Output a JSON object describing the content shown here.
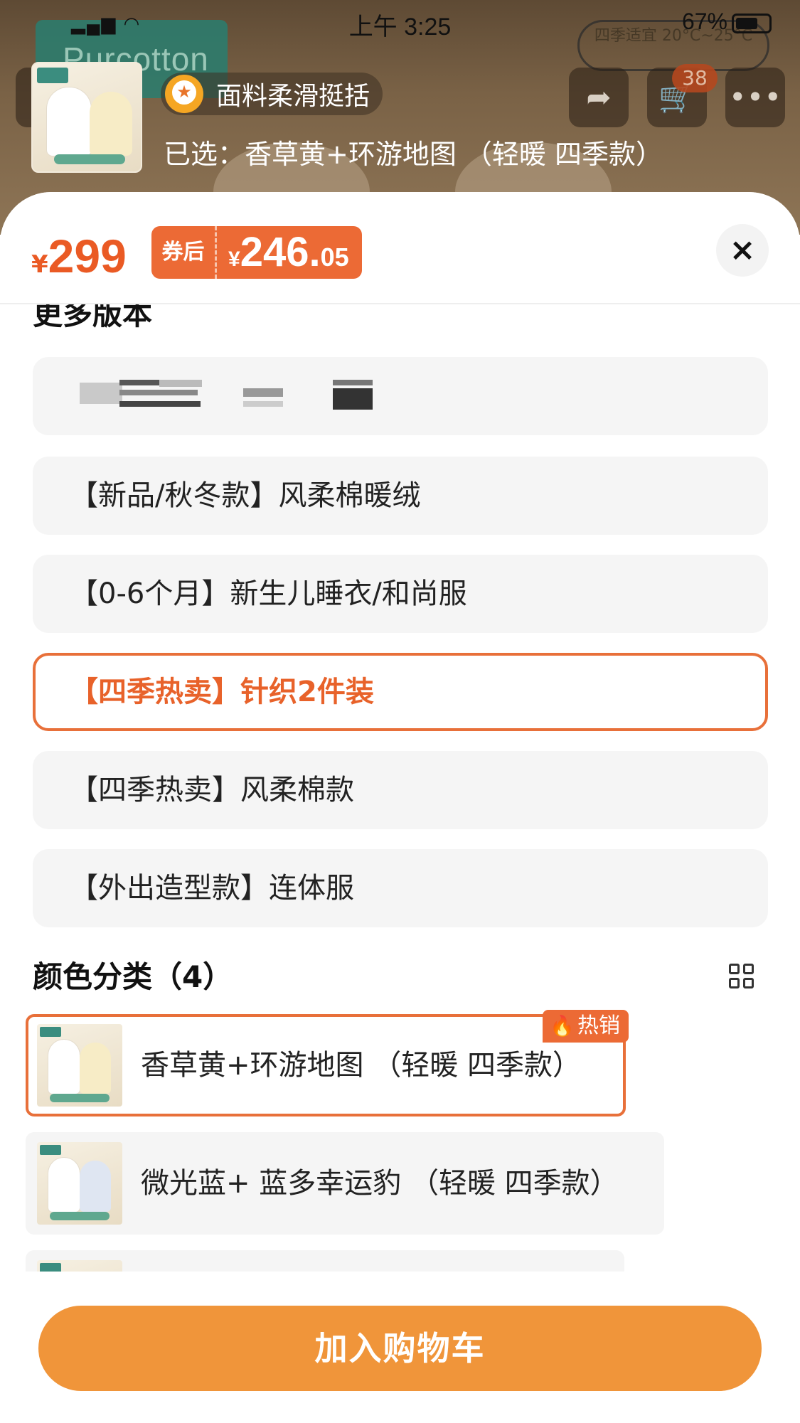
{
  "status_bar": {
    "time": "上午 3:25",
    "battery": "67%"
  },
  "background": {
    "brand": "Purcotton",
    "season_text": "四季适宜 20°C~25°C",
    "cart_count": "38"
  },
  "header": {
    "feature_badge": "面料柔滑挺括",
    "selected": "已选：香草黄+环游地图 （轻暖 四季款）"
  },
  "price": {
    "currency": "¥",
    "original": "299",
    "coupon_tag": "券后",
    "coupon_currency": "¥",
    "coupon_int": "246.",
    "coupon_dec": "05"
  },
  "close_icon": "×",
  "versions": {
    "title": "更多版本",
    "items": [
      {
        "label": ""
      },
      {
        "label": "【新品/秋冬款】风柔棉暖绒"
      },
      {
        "label": "【0-6个月】新生儿睡衣/和尚服"
      },
      {
        "label": "【四季热卖】针织2件装",
        "selected": true
      },
      {
        "label": "【四季热卖】风柔棉款"
      },
      {
        "label": "【外出造型款】连体服"
      }
    ]
  },
  "colors": {
    "title": "颜色分类（4）",
    "hot_label": "热销",
    "items": [
      {
        "label": "香草黄+环游地图 （轻暖  四季款）",
        "selected": true
      },
      {
        "label": "微光蓝+ 蓝多幸运豹 （轻暖  四季款）"
      },
      {
        "label": ""
      }
    ]
  },
  "add_to_cart": "加入购物车",
  "colors_accent": {
    "primary": "#e8703a",
    "cta": "#f0953a"
  }
}
